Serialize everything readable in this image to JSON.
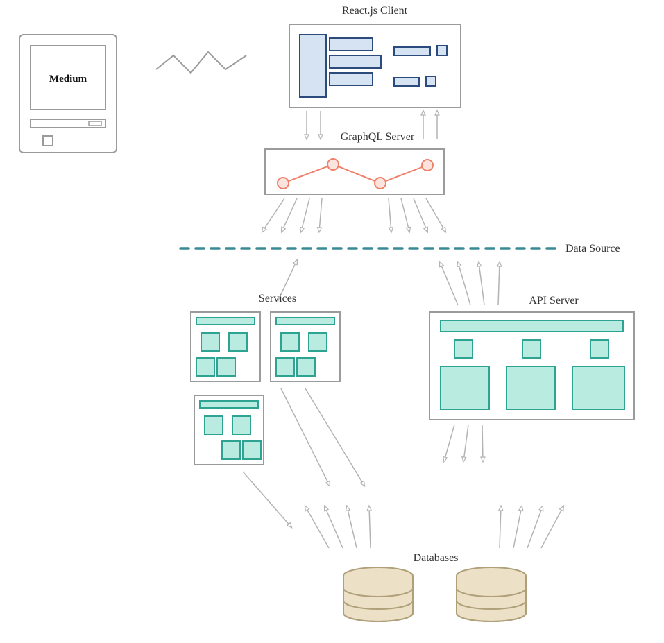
{
  "labels": {
    "react_client": "React.js Client",
    "graphql_server": "GraphQL Server",
    "data_source": "Data Source",
    "services": "Services",
    "api_server": "API Server",
    "databases": "Databases",
    "computer_screen": "Medium"
  },
  "colors": {
    "box_stroke": "#9b9b9b",
    "blue_fill": "#d6e3f3",
    "blue_stroke": "#2a4b7c",
    "teal_fill": "#baebe0",
    "teal_stroke": "#2fa391",
    "coral_stroke": "#f0806a",
    "coral_fill": "#fce4de",
    "dash_stroke": "#3a8a94",
    "tan_fill": "#ece1c6",
    "tan_stroke": "#b0a07a",
    "arrow_stroke": "#b3b3b3"
  },
  "architecture": {
    "nodes": [
      "ComputerTerminal",
      "ReactClient",
      "GraphQLServer",
      "DataSourceBoundary",
      "Services",
      "APIServer",
      "Databases"
    ],
    "flows": [
      [
        "ComputerTerminal",
        "ReactClient"
      ],
      [
        "ReactClient",
        "GraphQLServer",
        "bidirectional"
      ],
      [
        "GraphQLServer",
        "DataSourceBoundary",
        "fanout"
      ],
      [
        "DataSourceBoundary",
        "Services"
      ],
      [
        "DataSourceBoundary",
        "APIServer"
      ],
      [
        "Services",
        "Databases"
      ],
      [
        "APIServer",
        "Databases"
      ]
    ]
  }
}
